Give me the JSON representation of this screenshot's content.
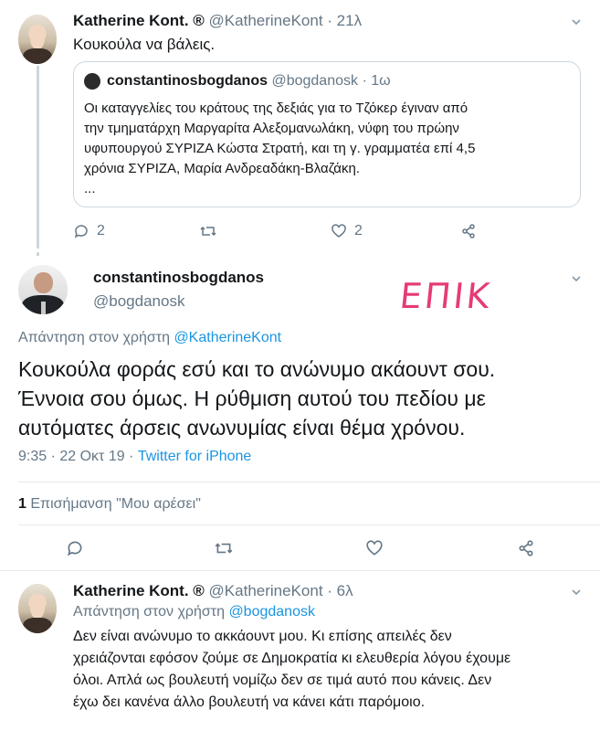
{
  "tweet1": {
    "name": "Katherine Kont. ®",
    "handle": "@KatherineKont",
    "time": "· 21λ",
    "text": "Κουκούλα να βάλεις.",
    "quote": {
      "name": "constantinosbogdanos",
      "handle": "@bogdanosk",
      "time": "· 1ω",
      "lines": [
        "Οι καταγγελίες του κράτους της δεξιάς για το Τζόκερ έγιναν από",
        "την τμηματάρχη Μαργαρίτα Αλεξομανωλάκη, νύφη του πρώην",
        "υφυπουργού ΣΥΡΙΖΑ Κώστα Στρατή, και τη γ. γραμματέα επί 4,5",
        "χρόνια ΣΥΡΙΖΑ, Μαρία Ανδρεαδάκη-Βλαζάκη.",
        "..."
      ]
    },
    "reply_count": "2",
    "like_count": "2"
  },
  "main_tweet": {
    "name": "constantinosbogdanos",
    "handle": "@bogdanosk",
    "overlay_text": "ΕΠΙΚ",
    "reply_prefix": "Απάντηση στον χρήστη",
    "reply_to": "@KatherineKont",
    "lines": [
      "Κουκούλα φοράς εσύ και το ανώνυμο ακάουντ σου.",
      "Έννοια σου όμως. Η ρύθμιση αυτού του πεδίου με",
      "αυτόματες άρσεις ανωνυμίας είναι θέμα χρόνου."
    ],
    "timestamp": "9:35 · 22 Οκτ 19 · ",
    "source": "Twitter for iPhone",
    "likes_count": "1",
    "likes_label": "Επισήμανση \"Μου αρέσει\""
  },
  "tweet3": {
    "name": "Katherine Kont. ®",
    "handle": "@KatherineKont",
    "time": "· 6λ",
    "reply_prefix": "Απάντηση στον χρήστη",
    "reply_to": "@bogdanosk",
    "lines": [
      "Δεν είναι ανώνυμο το ακκάουντ μου. Κι επίσης απειλές δεν",
      "χρειάζονται εφόσον ζούμε σε Δημοκρατία κι ελευθερία λόγου έχουμε",
      "όλοι. Απλά ως βουλευτή νομίζω δεν σε τιμά αυτό που κάνεις. Δεν",
      "έχω δει κανένα άλλο βουλευτή να κάνει κάτι παρόμοιο."
    ]
  }
}
